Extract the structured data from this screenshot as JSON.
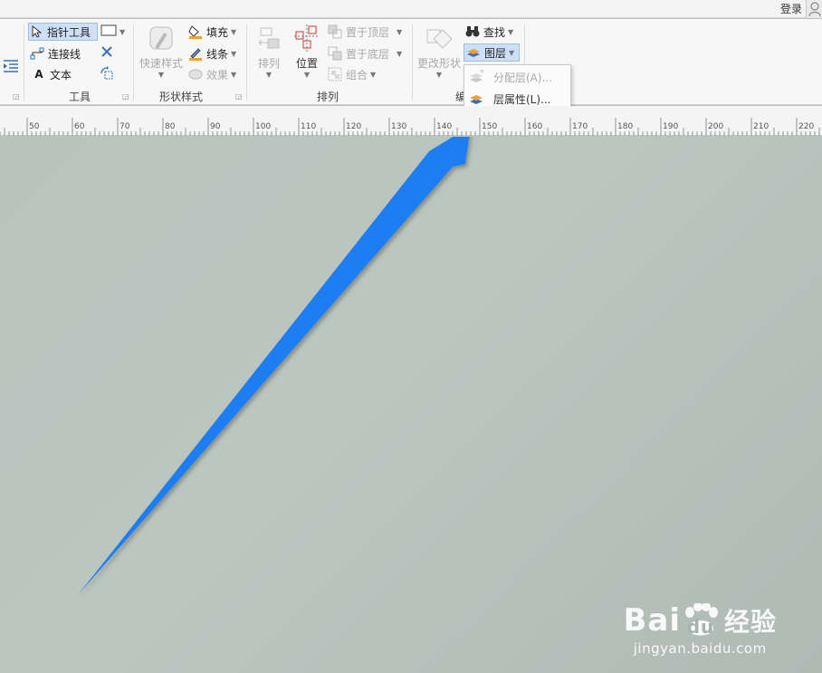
{
  "topbar": {
    "login_label": "登录"
  },
  "tools_group": {
    "label": "工具",
    "pointer_label": "指针工具",
    "connector_label": "连接线",
    "text_label": "文本"
  },
  "shape_style_group": {
    "label": "形状样式",
    "quick_style_label": "快速样式",
    "fill_label": "填充",
    "line_label": "线条",
    "effect_label": "效果"
  },
  "arrange_group": {
    "label": "排列",
    "arrange_label": "排列",
    "position_label": "位置",
    "bring_front_label": "置于顶层",
    "send_back_label": "置于底层",
    "group_label": "组合"
  },
  "edit_group": {
    "label_partial": "编",
    "change_shape_label": "更改形状",
    "find_label": "查找",
    "layer_label": "图层"
  },
  "layer_menu": {
    "items": [
      {
        "label": "分配层(A)...",
        "enabled": false
      },
      {
        "label": "层属性(L)...",
        "enabled": true
      }
    ]
  },
  "ruler": {
    "labels": [
      "50",
      "60",
      "70",
      "80",
      "90",
      "100",
      "110",
      "120",
      "130",
      "140",
      "150",
      "160",
      "170",
      "180",
      "190",
      "200",
      "210",
      "220"
    ]
  },
  "watermark": {
    "brand_left": "Bai",
    "brand_du": "du",
    "brand_cn": "经验",
    "url": "jingyan.baidu.com"
  },
  "colors": {
    "arrow": "#1f7ef2",
    "canvas": "#b9c3be",
    "selected": "#cde0f7"
  }
}
